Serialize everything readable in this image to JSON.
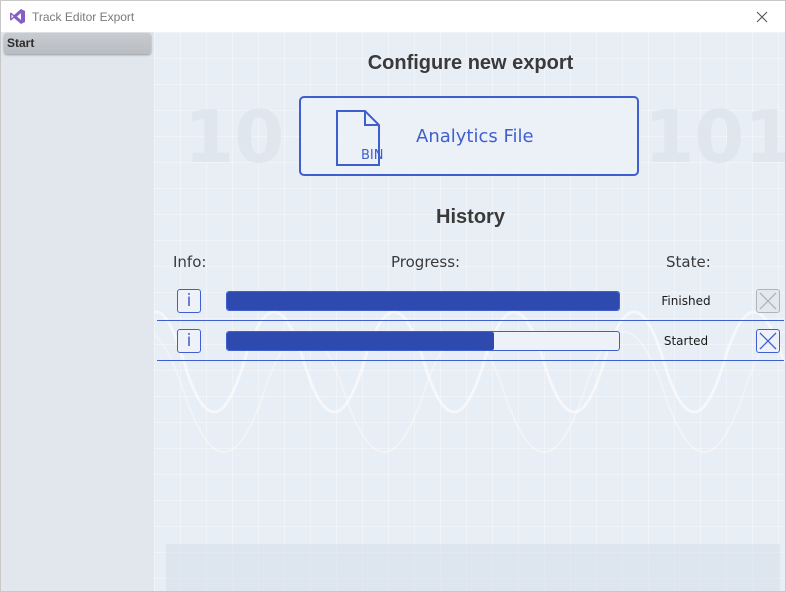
{
  "window": {
    "title": "Track Editor Export",
    "icon": "visual-studio-icon",
    "close_icon": "close-icon"
  },
  "sidebar": {
    "items": [
      {
        "label": "Start",
        "selected": true
      }
    ]
  },
  "main": {
    "configure_heading": "Configure new export",
    "export_option": {
      "icon": "bin-file-icon",
      "icon_text": "BIN",
      "label": "Analytics File"
    },
    "history_heading": "History",
    "columns": {
      "info": "Info:",
      "progress": "Progress:",
      "state": "State:"
    },
    "rows": [
      {
        "info_glyph": "i",
        "progress_percent": 100,
        "state": "Finished",
        "cancel_enabled": false
      },
      {
        "info_glyph": "i",
        "progress_percent": 68,
        "state": "Started",
        "cancel_enabled": true
      }
    ]
  },
  "colors": {
    "accent": "#3f5fd0",
    "progress_fill": "#2e4aae",
    "background": "#e8eef5"
  }
}
